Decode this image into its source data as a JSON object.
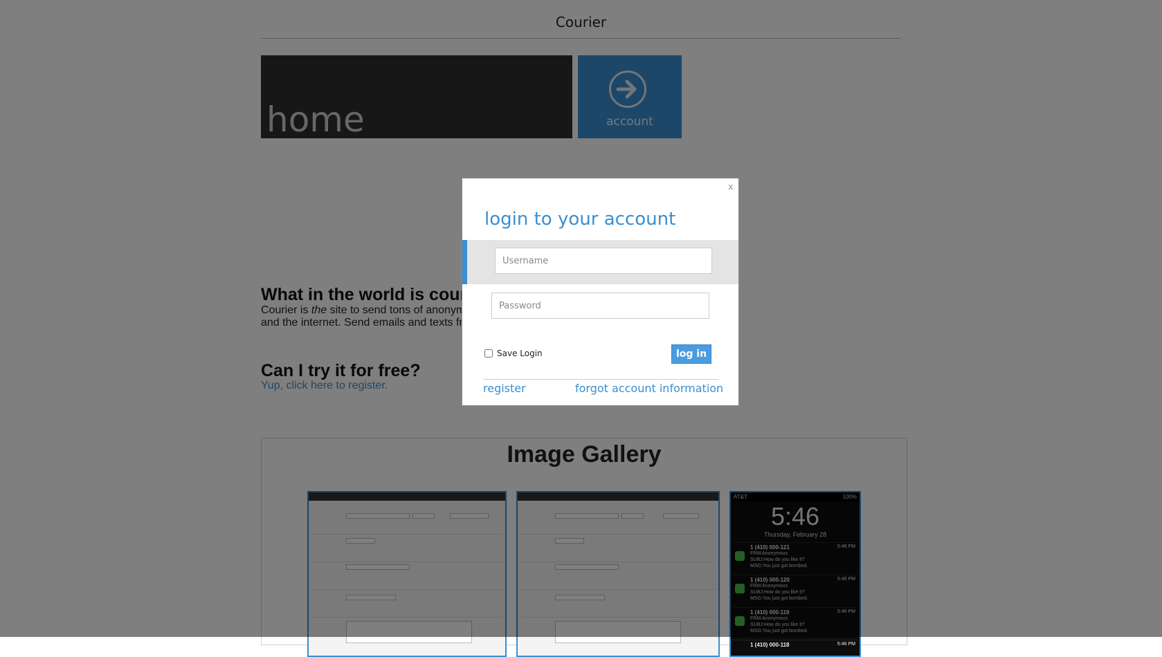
{
  "site": {
    "title": "Courier"
  },
  "tiles": {
    "home_label": "home",
    "account_label": "account"
  },
  "about": {
    "heading": "What in the world is cour",
    "line1_start": "Courier is ",
    "line1_em": "the",
    "line1_end": " site to send tons of anonym",
    "line2": "and the internet. Send emails and texts fr"
  },
  "free": {
    "heading": "Can I try it for free?",
    "link": "Yup, click here to register."
  },
  "gallery": {
    "title": "Image Gallery",
    "phone": {
      "carrier": "AT&T",
      "battery": "100%",
      "time": "5:46",
      "date": "Thursday, February 28",
      "messages": [
        {
          "from": "1 (410) 000-121",
          "time": "5:46 PM",
          "frm": "FRM:Anonymous",
          "subj": "SUBJ:How do you like it?",
          "msg": "MSG:You just got bombed."
        },
        {
          "from": "1 (410) 000-120",
          "time": "5:46 PM",
          "frm": "FRM:Anonymous",
          "subj": "SUBJ:How do you like it?",
          "msg": "MSG:You just got bombed."
        },
        {
          "from": "1 (410) 000-119",
          "time": "5:46 PM",
          "frm": "FRM:Anonymous",
          "subj": "SUBJ:How do you like it?",
          "msg": "MSG:You just got bombed."
        },
        {
          "from": "1 (410) 000-118",
          "time": "5:46 PM",
          "frm": "",
          "subj": "",
          "msg": ""
        }
      ]
    }
  },
  "modal": {
    "close": "x",
    "title": "login to your account",
    "username_placeholder": "Username",
    "password_placeholder": "Password",
    "save_label": "Save Login",
    "login_button": "log in",
    "register_link": "register",
    "forgot_link": "forgot account information"
  },
  "colors": {
    "accent": "#3a8fd0",
    "tile_dark": "#2f2f2f",
    "overlay": "rgba(0,0,0,0.5)"
  }
}
